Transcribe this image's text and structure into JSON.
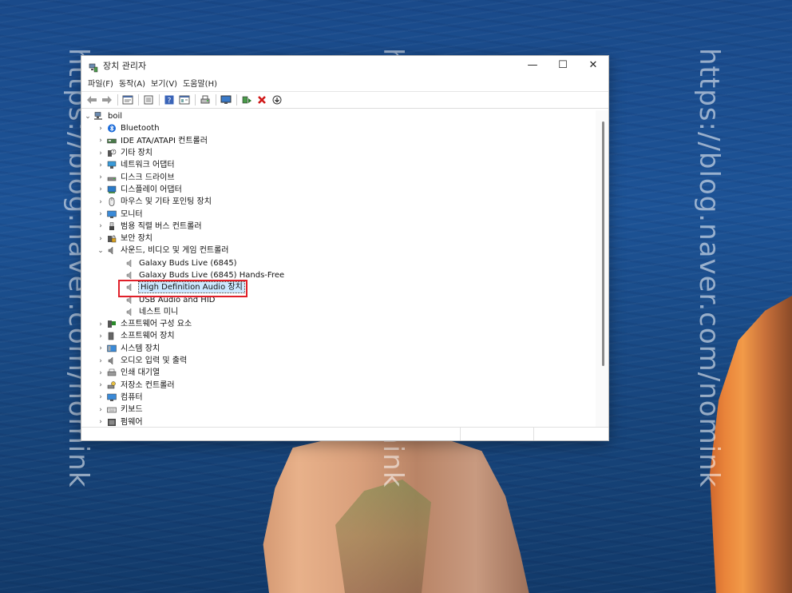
{
  "desktop": {
    "watermark": "https://blog.naver.com/nomink"
  },
  "window": {
    "title": "장치 관리자",
    "controls": {
      "minimize": "—",
      "maximize": "☐",
      "close": "✕"
    }
  },
  "menubar": {
    "items": [
      "파일(F)",
      "동작(A)",
      "보기(V)",
      "도움말(H)"
    ]
  },
  "toolbar": {
    "icons": [
      "back-icon",
      "forward-icon",
      "properties-icon",
      "list-icon",
      "help-icon",
      "view-icon",
      "print-icon",
      "monitor-icon",
      "update-driver-icon",
      "uninstall-icon",
      "download-icon"
    ]
  },
  "tree": {
    "root": {
      "label": "boil",
      "icon": "computer-icon"
    },
    "items": [
      {
        "label": "Bluetooth",
        "icon": "bluetooth-icon",
        "expanded": false
      },
      {
        "label": "IDE ATA/ATAPI 컨트롤러",
        "icon": "ide-controller-icon",
        "expanded": false
      },
      {
        "label": "기타 장치",
        "icon": "other-device-icon",
        "expanded": false
      },
      {
        "label": "네트워크 어댑터",
        "icon": "network-icon",
        "expanded": false
      },
      {
        "label": "디스크 드라이브",
        "icon": "disk-drive-icon",
        "expanded": false
      },
      {
        "label": "디스플레이 어댑터",
        "icon": "display-adapter-icon",
        "expanded": false
      },
      {
        "label": "마우스 및 기타 포인팅 장치",
        "icon": "mouse-icon",
        "expanded": false
      },
      {
        "label": "모니터",
        "icon": "monitor-icon",
        "expanded": false
      },
      {
        "label": "범용 직렬 버스 컨트롤러",
        "icon": "usb-icon",
        "expanded": false
      },
      {
        "label": "보안 장치",
        "icon": "security-device-icon",
        "expanded": false
      },
      {
        "label": "사운드, 비디오 및 게임 컨트롤러",
        "icon": "speaker-icon",
        "expanded": true,
        "children": [
          {
            "label": "Galaxy Buds Live (6845)"
          },
          {
            "label": "Galaxy Buds Live (6845) Hands-Free"
          },
          {
            "label": "High Definition Audio 장치",
            "selected": true
          },
          {
            "label": "USB Audio and HID"
          },
          {
            "label": "네스트 미니"
          }
        ]
      },
      {
        "label": "소프트웨어 구성 요소",
        "icon": "software-component-icon",
        "expanded": false
      },
      {
        "label": "소프트웨어 장치",
        "icon": "software-device-icon",
        "expanded": false
      },
      {
        "label": "시스템 장치",
        "icon": "system-device-icon",
        "expanded": false
      },
      {
        "label": "오디오 입력 및 출력",
        "icon": "audio-io-icon",
        "expanded": false
      },
      {
        "label": "인쇄 대기열",
        "icon": "printer-icon",
        "expanded": false
      },
      {
        "label": "저장소 컨트롤러",
        "icon": "storage-controller-icon",
        "expanded": false
      },
      {
        "label": "컴퓨터",
        "icon": "computer-icon",
        "expanded": false
      },
      {
        "label": "키보드",
        "icon": "keyboard-icon",
        "expanded": false
      },
      {
        "label": "펌웨어",
        "icon": "firmware-icon",
        "expanded": false
      }
    ]
  },
  "colors": {
    "highlight_border": "#e0202a",
    "selection_bg": "#cce8ff"
  }
}
